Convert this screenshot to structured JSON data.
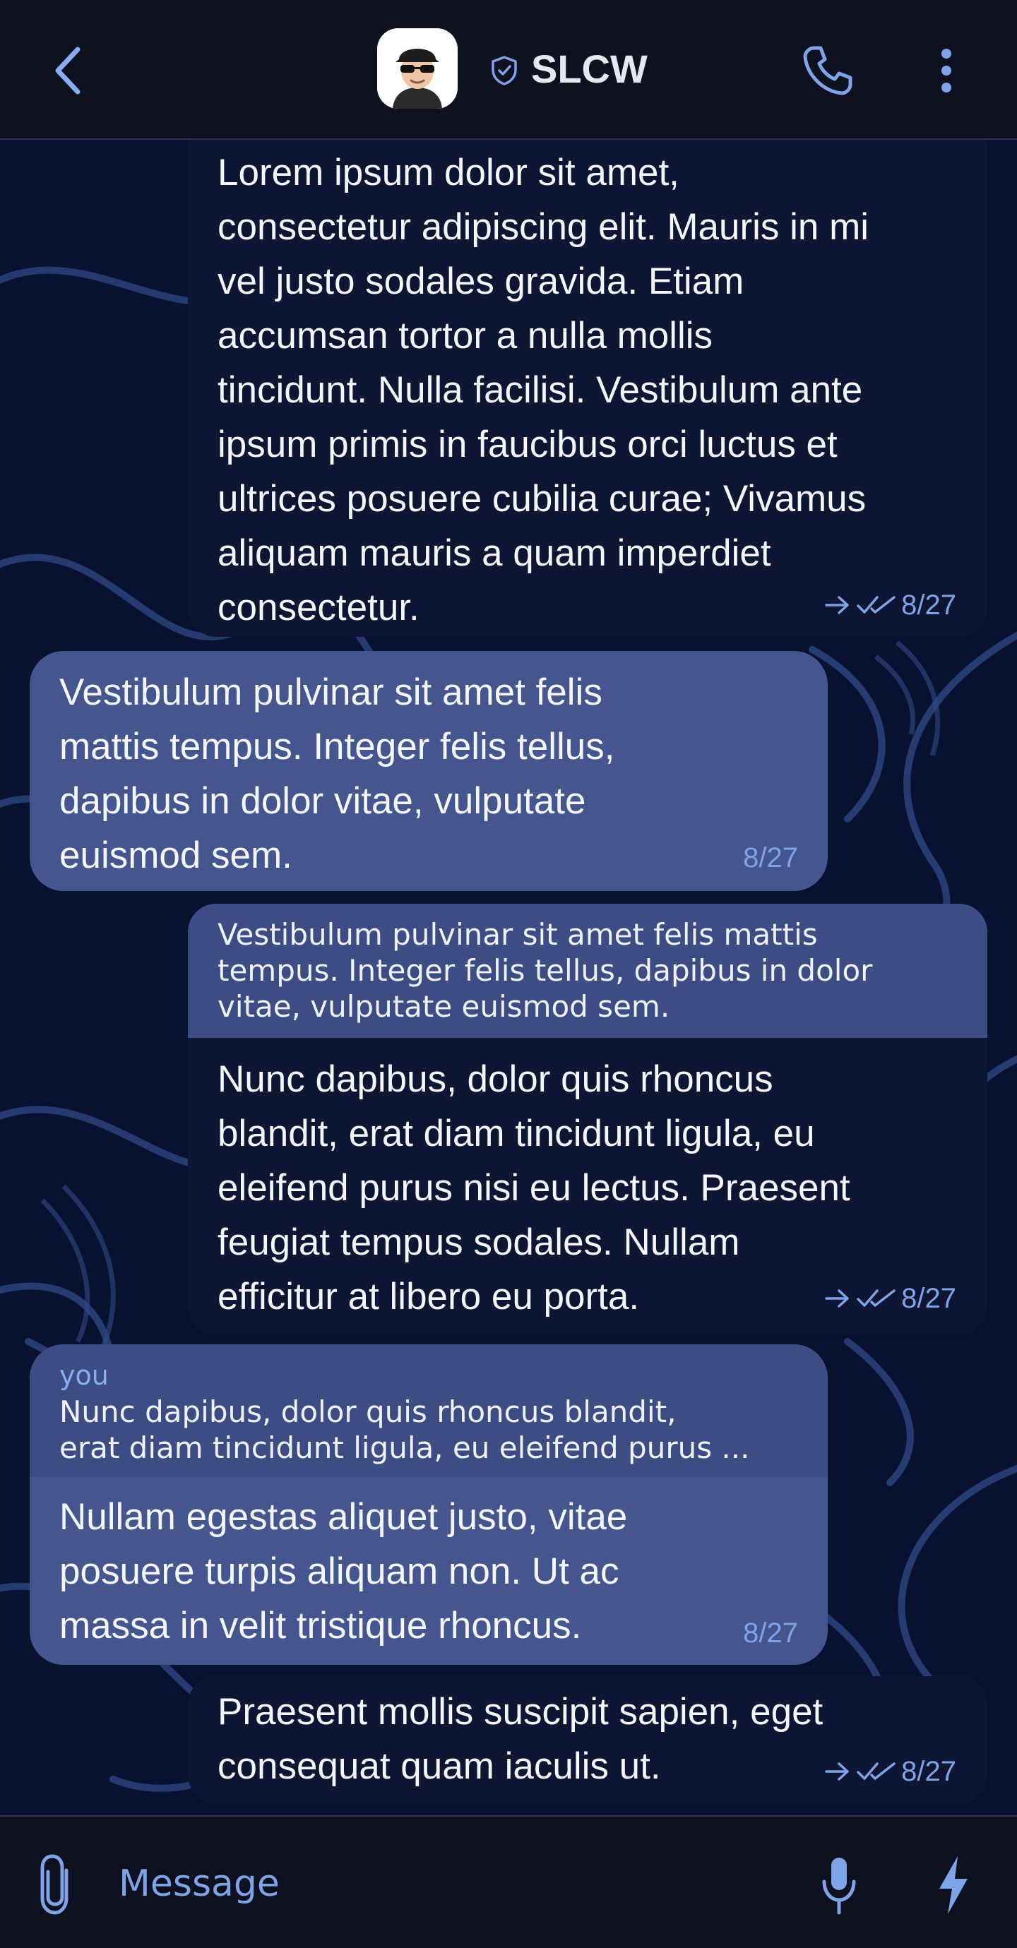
{
  "header": {
    "back_icon": "chevron-left-icon",
    "avatar_icon": "avatar-memoji-sunglasses",
    "verified_icon": "shield-check-icon",
    "contact_name": "SLCW",
    "call_icon": "phone-icon",
    "more_icon": "vertical-dots-icon"
  },
  "messages": [
    {
      "direction": "out",
      "text": "Lorem ipsum dolor sit amet,\nconsectetur adipiscing elit. Mauris in mi\nvel justo sodales gravida. Etiam\naccumsan tortor a nulla mollis\ntincidunt. Nulla facilisi. Vestibulum ante\nipsum primis in faucibus orci luctus et\nultrices posuere cubilia curae; Vivamus\naliquam mauris a quam imperdiet\nconsectetur.",
      "time": "8/27"
    },
    {
      "direction": "in",
      "text": "Vestibulum pulvinar sit amet felis\nmattis tempus. Integer felis tellus,\ndapibus in dolor vitae, vulputate\neuismod sem.",
      "time": "8/27"
    },
    {
      "direction": "out",
      "quote": {
        "text": "Vestibulum pulvinar sit amet felis mattis\ntempus. Integer felis tellus, dapibus in dolor\nvitae, vulputate euismod sem."
      },
      "text": "Nunc dapibus, dolor quis rhoncus\nblandit, erat diam tincidunt ligula, eu\neleifend purus nisi eu lectus. Praesent\nfeugiat tempus sodales. Nullam\nefficitur at libero eu porta.",
      "time": "8/27"
    },
    {
      "direction": "in",
      "quote": {
        "author": "you",
        "text": "Nunc dapibus, dolor quis rhoncus blandit,\nerat diam tincidunt ligula, eu eleifend purus ..."
      },
      "text": "Nullam egestas aliquet justo, vitae\nposuere turpis aliquam non. Ut ac\nmassa in velit tristique rhoncus.",
      "time": "8/27"
    },
    {
      "direction": "out",
      "text": "Praesent mollis suscipit sapien, eget\nconsequat quam iaculis ut.",
      "time": "8/27"
    }
  ],
  "status_icons": {
    "forward": "arrow-right-icon",
    "read": "double-check-icon"
  },
  "input_bar": {
    "attach_icon": "paperclip-icon",
    "placeholder": "Message",
    "mic_icon": "microphone-icon",
    "bolt_icon": "lightning-icon"
  },
  "colors": {
    "background": "#0a1231",
    "header": "#0d1120",
    "incoming_bubble": "#45568f",
    "outgoing_bubble": "#0e1633",
    "quote_bubble": "#3d4c82",
    "accent": "#7ea3e6",
    "pattern_stroke": "#2f4a86"
  }
}
